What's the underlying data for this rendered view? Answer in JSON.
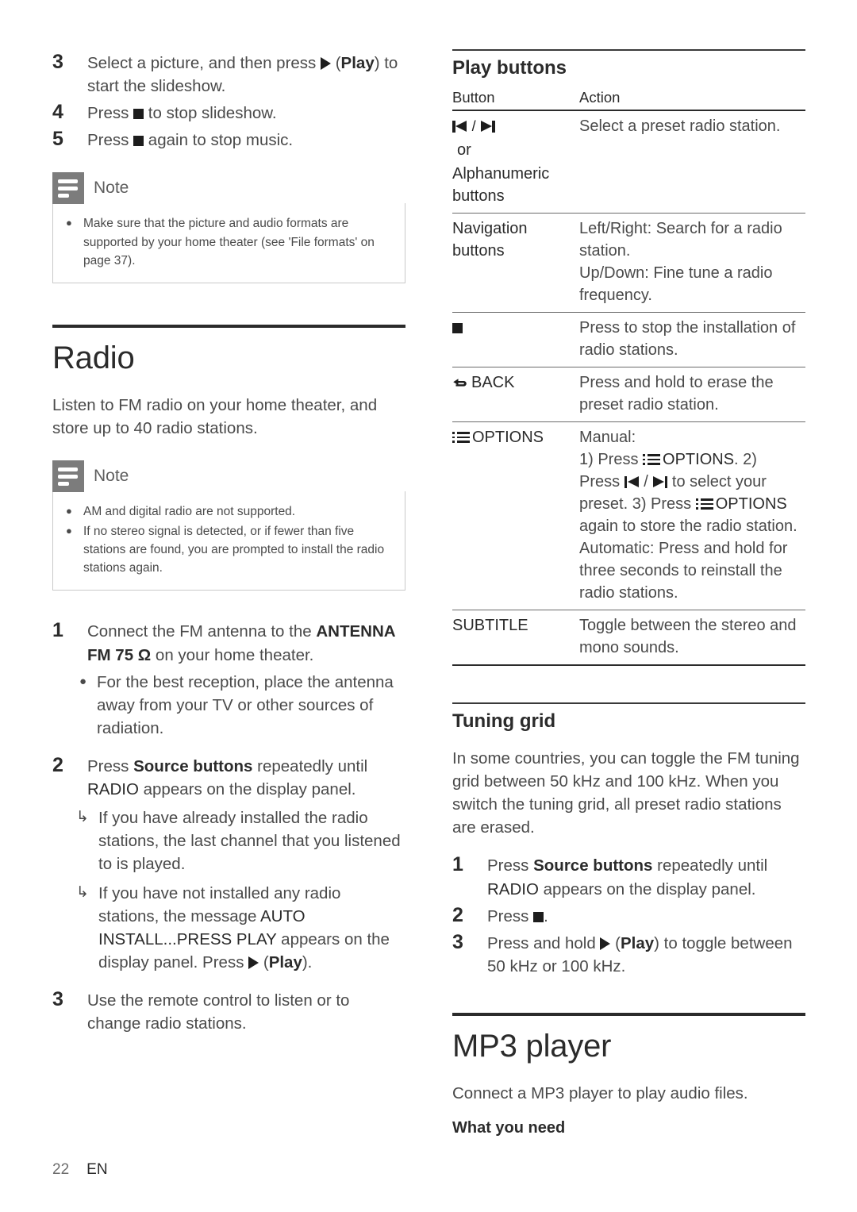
{
  "page": {
    "number": "22",
    "language": "EN"
  },
  "left_column": {
    "steps_slideshow": [
      {
        "num": "3",
        "text_before": "Select a picture, and then press ",
        "icon": "play-triangle-icon",
        "text_after": " (Play) to start the slideshow.",
        "bold_part": "Play"
      },
      {
        "num": "4",
        "text_before": "Press ",
        "icon": "stop-square-icon",
        "text_after": " to stop slideshow."
      },
      {
        "num": "5",
        "text_before": "Press ",
        "icon": "stop-square-icon",
        "text_after": " again to stop music."
      }
    ],
    "note_1": {
      "label": "Note",
      "items": [
        "Make sure that the picture and audio formats are supported by your home theater (see 'File formats' on page 37)."
      ]
    },
    "radio": {
      "heading": "Radio",
      "intro": "Listen to FM radio on your home theater, and store up to 40 radio stations.",
      "note": {
        "label": "Note",
        "items": [
          "AM and digital radio are not supported.",
          "If no stereo signal is detected, or if fewer than five stations are found, you are prompted to install the radio stations again."
        ]
      },
      "step1": {
        "num": "1",
        "line1": "Connect the FM antenna to the",
        "bold": "ANTENNA FM 75 Ω",
        "line2_after": " on your home theater.",
        "bullet": "For the best reception, place the antenna away from your TV or other sources of radiation."
      },
      "step2": {
        "num": "2",
        "pre": "Press ",
        "bold_source": "Source buttons",
        "mid": " repeatedly until ",
        "caps_radio": "RADIO",
        "post": " appears on the display panel.",
        "arrow1": "If you have already installed the radio stations, the last channel that you listened to is played.",
        "arrow2_a": "If you have not installed any radio stations, the message ",
        "arrow2_caps1": "AUTO INSTALL...PRESS PLAY",
        "arrow2_b": " appears on the display panel. Press ",
        "arrow2_c": " (Play).",
        "arrow2_play_bold": "Play"
      },
      "step3": {
        "num": "3",
        "text": "Use the remote control to listen or to change radio stations."
      }
    }
  },
  "right_column": {
    "play_buttons": {
      "heading": "Play buttons",
      "columns": [
        "Button",
        "Action"
      ],
      "rows": [
        {
          "button_icons": [
            "prev-track-icon",
            "next-track-icon"
          ],
          "button_separator": " / ",
          "button_or": "or",
          "button_extra": "Alphanumeric buttons",
          "action": "Select a preset radio station."
        },
        {
          "button_label": "Navigation buttons",
          "action_lines": [
            "Left/Right: Search for a radio station.",
            "Up/Down: Fine tune a radio frequency."
          ]
        },
        {
          "button_icons": [
            "stop-square-icon"
          ],
          "action": "Press to stop the installation of radio stations."
        },
        {
          "button_icon": "back-arrow-icon",
          "button_label": "BACK",
          "action": "Press and hold to erase the preset radio station."
        },
        {
          "button_icon": "options-list-icon",
          "button_label": "OPTIONS",
          "action_manual_title": "Manual:",
          "action_step1": "1) Press ",
          "action_options_1": "OPTIONS",
          "action_step1_end": ". 2) Press ",
          "action_step2_end": " to select your preset. 3) Press ",
          "action_options_2": "OPTIONS",
          "action_step3_end": " again to store the radio station.",
          "action_auto": "Automatic: Press and hold for three seconds to reinstall the radio stations."
        },
        {
          "button_label": "SUBTITLE",
          "action": "Toggle between the stereo and mono sounds."
        }
      ]
    },
    "tuning_grid": {
      "heading": "Tuning grid",
      "intro": "In some countries, you can toggle the FM tuning grid between 50 kHz and 100 kHz. When you switch the tuning grid, all preset radio stations are erased.",
      "steps": [
        {
          "num": "1",
          "pre": "Press ",
          "bold_source": "Source buttons",
          "mid": " repeatedly until ",
          "caps_radio": "RADIO",
          "post": " appears on the display panel."
        },
        {
          "num": "2",
          "pre": "Press ",
          "post": "."
        },
        {
          "num": "3",
          "pre": "Press and hold ",
          "play_bold": "Play",
          "post": " (Play) to toggle between 50 kHz or 100 kHz."
        }
      ]
    },
    "mp3_player": {
      "heading": "MP3 player",
      "intro": "Connect a MP3 player to play audio files.",
      "subheading": "What you need"
    }
  }
}
